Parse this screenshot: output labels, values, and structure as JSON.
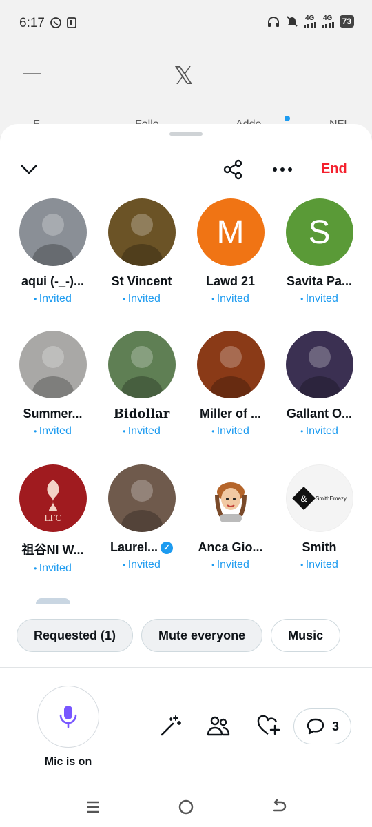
{
  "status_bar": {
    "time": "6:17",
    "battery": "73",
    "signal_1": "4G",
    "signal_2": "4G"
  },
  "background_app": {
    "tabs": [
      "F",
      "Follo",
      "Adde",
      "NFL"
    ]
  },
  "header": {
    "end_label": "End"
  },
  "participants": [
    {
      "name": "aqui (-_-)...",
      "status": "Invited",
      "avatar_color": "#8a8f96",
      "avatar_style": "cats"
    },
    {
      "name": "St Vincent",
      "status": "Invited",
      "avatar_color": "#6b5326",
      "avatar_style": "frame"
    },
    {
      "name": "Lawd 21",
      "status": "Invited",
      "avatar_color": "#f07414",
      "avatar_letter": "M"
    },
    {
      "name": "Savita Pa...",
      "status": "Invited",
      "avatar_color": "#5a9a37",
      "avatar_letter": "S"
    },
    {
      "name": "Summer...",
      "status": "Invited",
      "avatar_color": "#a9a8a6",
      "avatar_style": "person"
    },
    {
      "name": "Bidollar",
      "status": "Invited",
      "avatar_color": "#5f7f54",
      "avatar_style": "portrait",
      "serif": true
    },
    {
      "name": "Miller of ...",
      "status": "Invited",
      "avatar_color": "#8a3a17",
      "avatar_style": "anime"
    },
    {
      "name": "Gallant O...",
      "status": "Invited",
      "avatar_color": "#3b3052",
      "avatar_style": "anime2"
    },
    {
      "name": "祖谷NI W...",
      "status": "Invited",
      "avatar_color": "#a01b1f",
      "avatar_style": "lfc"
    },
    {
      "name": "Laurel...",
      "status": "Invited",
      "avatar_color": "#6f5a4c",
      "avatar_style": "face",
      "verified": true
    },
    {
      "name": "Anca Gio...",
      "status": "Invited",
      "avatar_color": "#ffffff",
      "avatar_style": "cartoon"
    },
    {
      "name": "Smith",
      "status": "Invited",
      "avatar_color": "#f4f4f4",
      "avatar_style": "logo",
      "logo_text": "SmithEmazy"
    }
  ],
  "actions": {
    "requested": "Requested (1)",
    "mute": "Mute everyone",
    "music": "Music"
  },
  "controls": {
    "mic_label": "Mic is on",
    "comment_count": "3"
  },
  "colors": {
    "accent": "#1d9bf0",
    "end": "#f4212e",
    "mic": "#7856ff"
  },
  "icons": [
    "chevron-down-icon",
    "share-icon",
    "more-icon",
    "mic-icon",
    "magic-wand-icon",
    "people-icon",
    "heart-plus-icon",
    "comment-icon"
  ]
}
